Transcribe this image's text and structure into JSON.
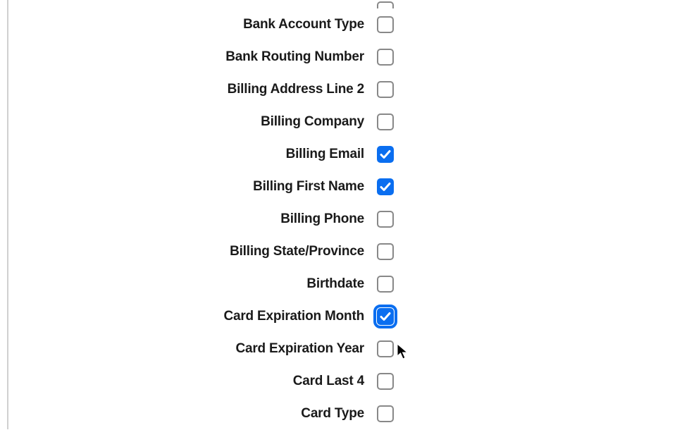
{
  "fields": [
    {
      "id": "bank-account-type",
      "label": "Bank Account Type",
      "checked": false,
      "focused": false
    },
    {
      "id": "bank-routing-number",
      "label": "Bank Routing Number",
      "checked": false,
      "focused": false
    },
    {
      "id": "billing-address-line-2",
      "label": "Billing Address Line 2",
      "checked": false,
      "focused": false
    },
    {
      "id": "billing-company",
      "label": "Billing Company",
      "checked": false,
      "focused": false
    },
    {
      "id": "billing-email",
      "label": "Billing Email",
      "checked": true,
      "focused": false
    },
    {
      "id": "billing-first-name",
      "label": "Billing First Name",
      "checked": true,
      "focused": false
    },
    {
      "id": "billing-phone",
      "label": "Billing Phone",
      "checked": false,
      "focused": false
    },
    {
      "id": "billing-state-province",
      "label": "Billing State/Province",
      "checked": false,
      "focused": false
    },
    {
      "id": "birthdate",
      "label": "Birthdate",
      "checked": false,
      "focused": false
    },
    {
      "id": "card-expiration-month",
      "label": "Card Expiration Month",
      "checked": true,
      "focused": true
    },
    {
      "id": "card-expiration-year",
      "label": "Card Expiration Year",
      "checked": false,
      "focused": false
    },
    {
      "id": "card-last-4",
      "label": "Card Last 4",
      "checked": false,
      "focused": false
    },
    {
      "id": "card-type",
      "label": "Card Type",
      "checked": false,
      "focused": false
    }
  ]
}
